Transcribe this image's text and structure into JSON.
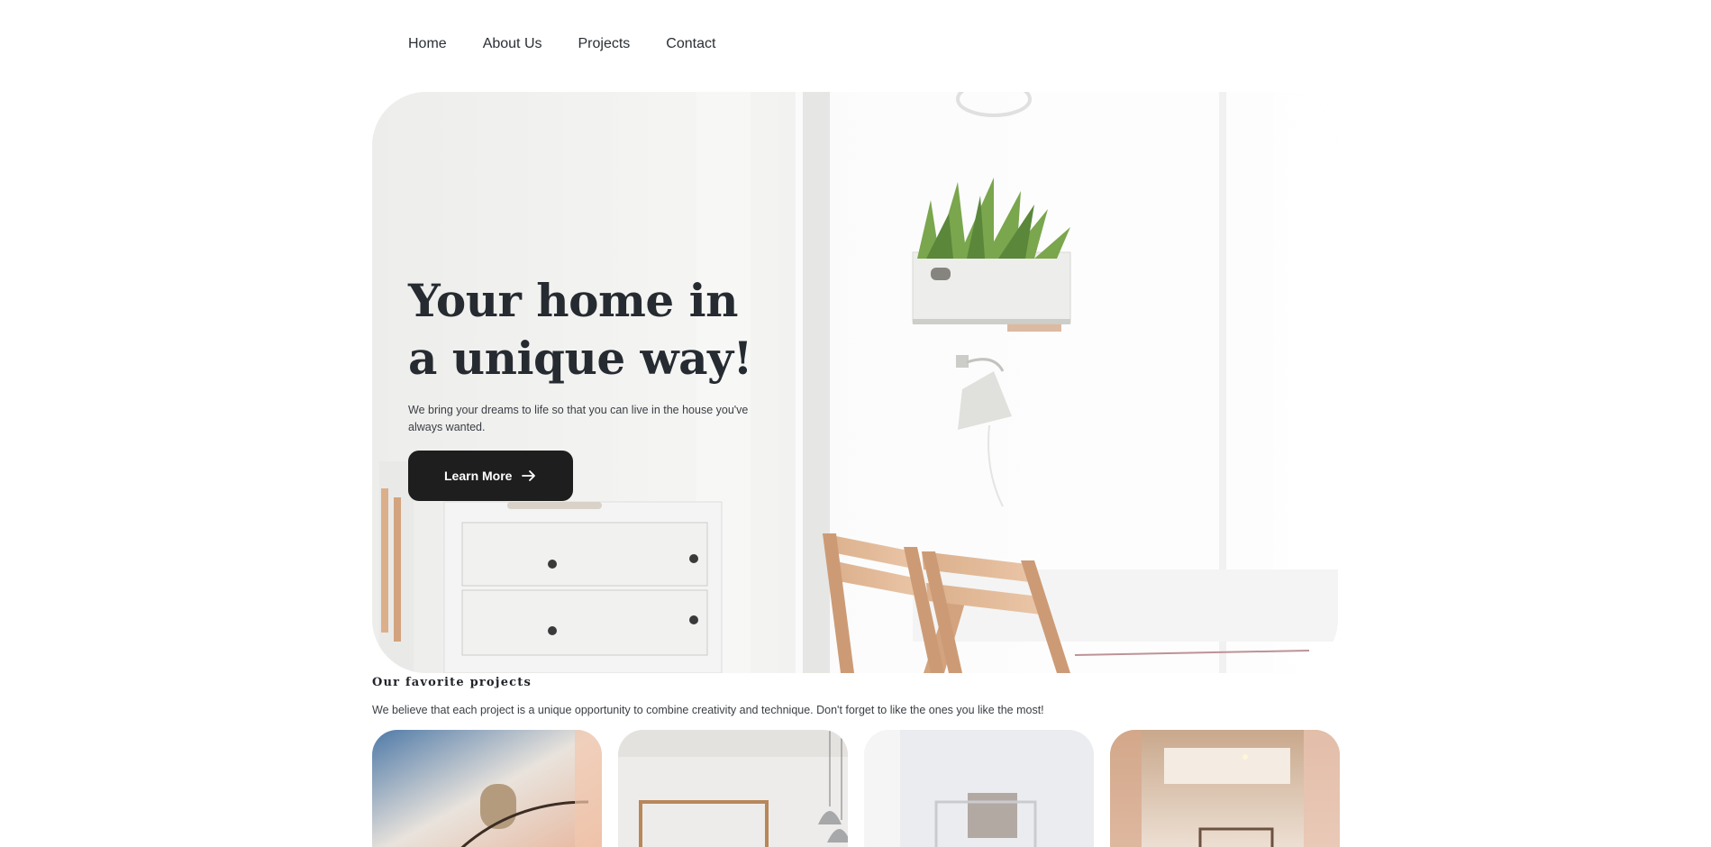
{
  "nav": {
    "items": [
      "Home",
      "About Us",
      "Projects",
      "Contact"
    ]
  },
  "hero": {
    "title": "Your home in a unique way!",
    "subtitle": "We bring your dreams to life so that you can live in the house you've always wanted.",
    "button_label": "Learn More",
    "button_icon": "arrow-right-icon"
  },
  "projects": {
    "title": "Our favorite projects",
    "subtitle": "We believe that each project is a unique opportunity to combine creativity and technique. Don't forget to like the ones you like the most!"
  },
  "colors": {
    "button_bg": "#1e1e1e",
    "heading": "#262b31",
    "text": "#3a3f44"
  }
}
